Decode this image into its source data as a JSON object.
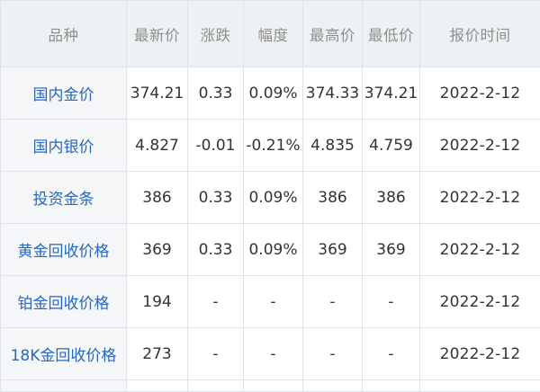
{
  "table": {
    "headers": [
      "品种",
      "最新价",
      "涨跌",
      "幅度",
      "最高价",
      "最低价",
      "报价时间"
    ],
    "rows": [
      {
        "name": "国内金价",
        "latest": "374.21",
        "change": "0.33",
        "range": "0.09%",
        "high": "374.33",
        "low": "374.21",
        "time": "2022-2-12"
      },
      {
        "name": "国内银价",
        "latest": "4.827",
        "change": "-0.01",
        "range": "-0.21%",
        "high": "4.835",
        "low": "4.759",
        "time": "2022-2-12"
      },
      {
        "name": "投资金条",
        "latest": "386",
        "change": "0.33",
        "range": "0.09%",
        "high": "386",
        "low": "386",
        "time": "2022-2-12"
      },
      {
        "name": "黄金回收价格",
        "latest": "369",
        "change": "0.33",
        "range": "0.09%",
        "high": "369",
        "low": "369",
        "time": "2022-2-12"
      },
      {
        "name": "铂金回收价格",
        "latest": "194",
        "change": "-",
        "range": "-",
        "high": "-",
        "low": "-",
        "time": "2022-2-12"
      },
      {
        "name": "18K金回收价格",
        "latest": "273",
        "change": "-",
        "range": "-",
        "high": "-",
        "low": "-",
        "time": "2022-2-12"
      }
    ]
  },
  "colors": {
    "header_bg": "#eef1f3",
    "header_text": "#8e8e8e",
    "link_blue": "#2a67b6",
    "cell_text": "#333333",
    "border": "#dfe3e7"
  }
}
